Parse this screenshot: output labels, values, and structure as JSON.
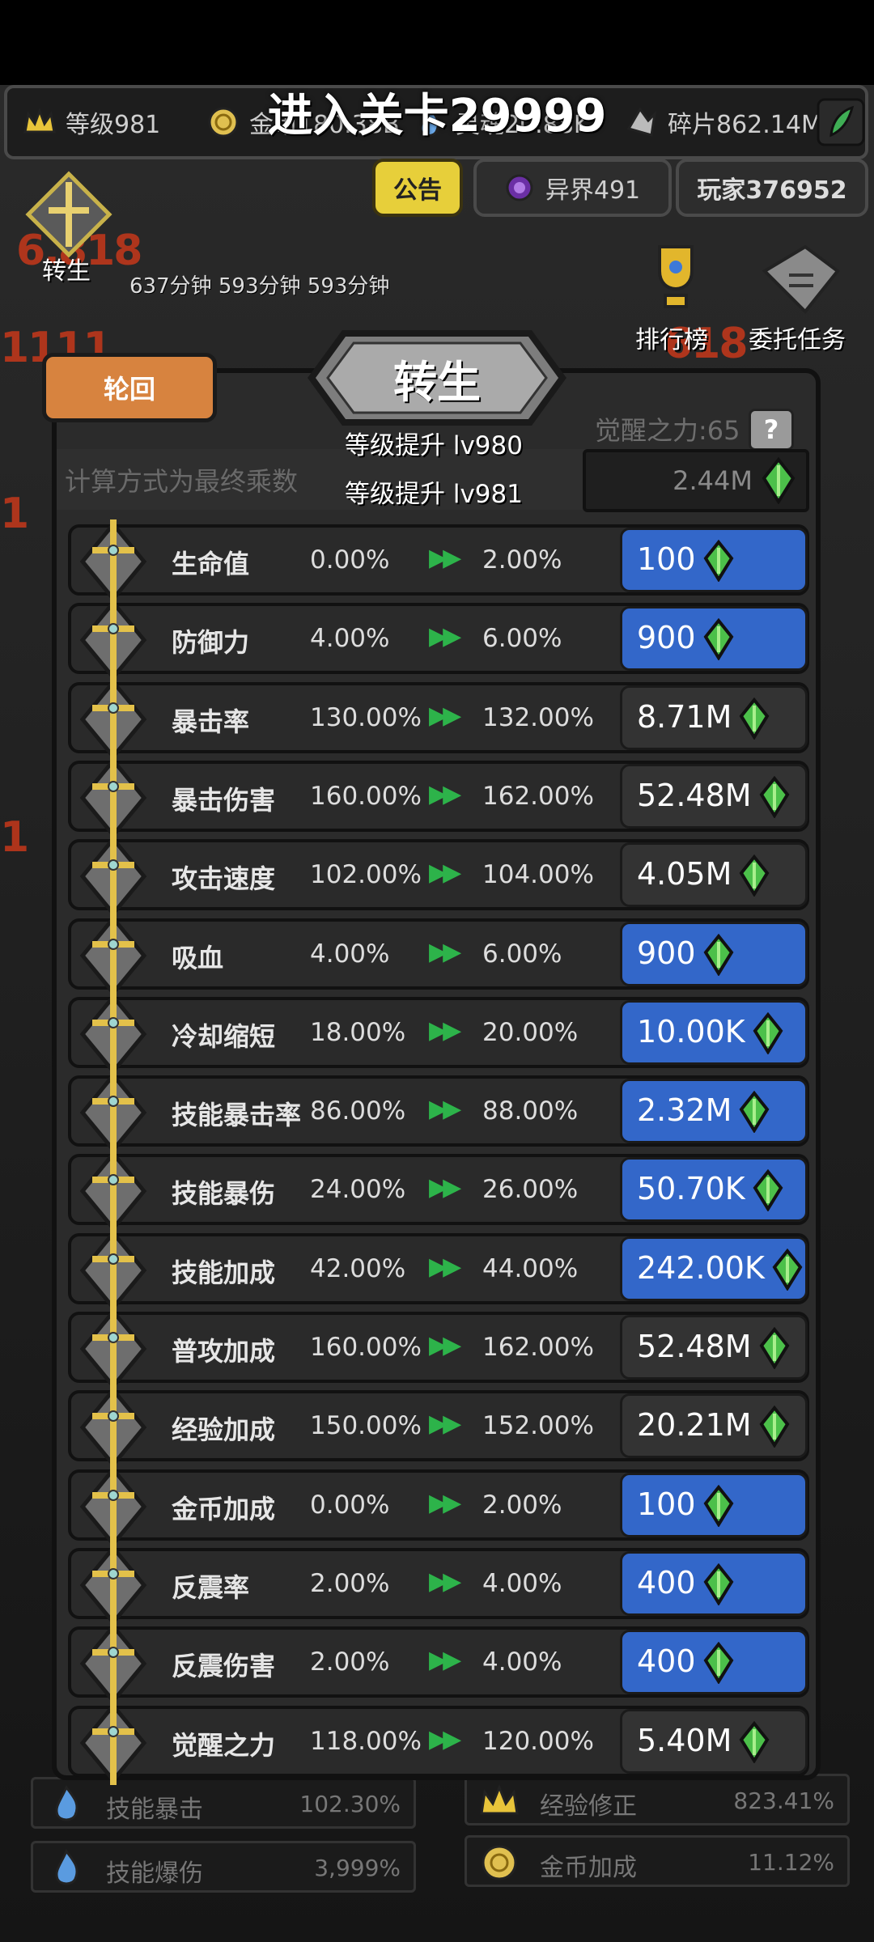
{
  "top": {
    "level_entry": "进入关卡29999",
    "resources": [
      {
        "name": "level",
        "label": "等级981"
      },
      {
        "name": "gold",
        "label": "金币180.38B"
      },
      {
        "name": "soul",
        "label": "灵魂20.88K"
      },
      {
        "name": "fragment",
        "label": "碎片862.14M"
      }
    ],
    "notice_label": "公告",
    "otherworld_label": "异界491",
    "player_label": "玩家376952",
    "reincarnation_side_label": "转生",
    "timer_text": "637分钟 593分钟 593分钟",
    "ranking_label": "排行榜",
    "commission_label": "委托任务"
  },
  "panel": {
    "cycle_tab": "轮回",
    "title": "转生",
    "awaken_power": "觉醒之力:65",
    "help": "?",
    "calc_note": "计算方式为最终乘数",
    "level_up_from": "等级提升 lv980",
    "level_up_to": "等级提升 lv981",
    "cost": "2.44M",
    "rows": [
      {
        "name": "生命值",
        "cur": "0.00%",
        "next": "2.00%",
        "price": "100",
        "style": "blue"
      },
      {
        "name": "防御力",
        "cur": "4.00%",
        "next": "6.00%",
        "price": "900",
        "style": "blue"
      },
      {
        "name": "暴击率",
        "cur": "130.00%",
        "next": "132.00%",
        "price": "8.71M",
        "style": "gray"
      },
      {
        "name": "暴击伤害",
        "cur": "160.00%",
        "next": "162.00%",
        "price": "52.48M",
        "style": "gray"
      },
      {
        "name": "攻击速度",
        "cur": "102.00%",
        "next": "104.00%",
        "price": "4.05M",
        "style": "gray"
      },
      {
        "name": "吸血",
        "cur": "4.00%",
        "next": "6.00%",
        "price": "900",
        "style": "blue"
      },
      {
        "name": "冷却缩短",
        "cur": "18.00%",
        "next": "20.00%",
        "price": "10.00K",
        "style": "blue"
      },
      {
        "name": "技能暴击率",
        "cur": "86.00%",
        "next": "88.00%",
        "price": "2.32M",
        "style": "blue"
      },
      {
        "name": "技能暴伤",
        "cur": "24.00%",
        "next": "26.00%",
        "price": "50.70K",
        "style": "blue"
      },
      {
        "name": "技能加成",
        "cur": "42.00%",
        "next": "44.00%",
        "price": "242.00K",
        "style": "blue"
      },
      {
        "name": "普攻加成",
        "cur": "160.00%",
        "next": "162.00%",
        "price": "52.48M",
        "style": "gray"
      },
      {
        "name": "经验加成",
        "cur": "150.00%",
        "next": "152.00%",
        "price": "20.21M",
        "style": "gray"
      },
      {
        "name": "金币加成",
        "cur": "0.00%",
        "next": "2.00%",
        "price": "100",
        "style": "blue"
      },
      {
        "name": "反震率",
        "cur": "2.00%",
        "next": "4.00%",
        "price": "400",
        "style": "blue"
      },
      {
        "name": "反震伤害",
        "cur": "2.00%",
        "next": "4.00%",
        "price": "400",
        "style": "blue"
      },
      {
        "name": "觉醒之力",
        "cur": "118.00%",
        "next": "120.00%",
        "price": "5.40M",
        "style": "gray"
      }
    ]
  },
  "bottom_stats": [
    {
      "label": "技能暴击",
      "value": "102.30%"
    },
    {
      "label": "技能爆伤",
      "value": "3,999%"
    },
    {
      "label": "经验修正",
      "value": "823.41%"
    },
    {
      "label": "金币加成",
      "value": "11.12%"
    }
  ],
  "colors": {
    "buy_blue": "#3367c9",
    "buy_gray": "#333333",
    "tab_orange": "#d7833f",
    "notice_yellow": "#e7cf3a"
  }
}
